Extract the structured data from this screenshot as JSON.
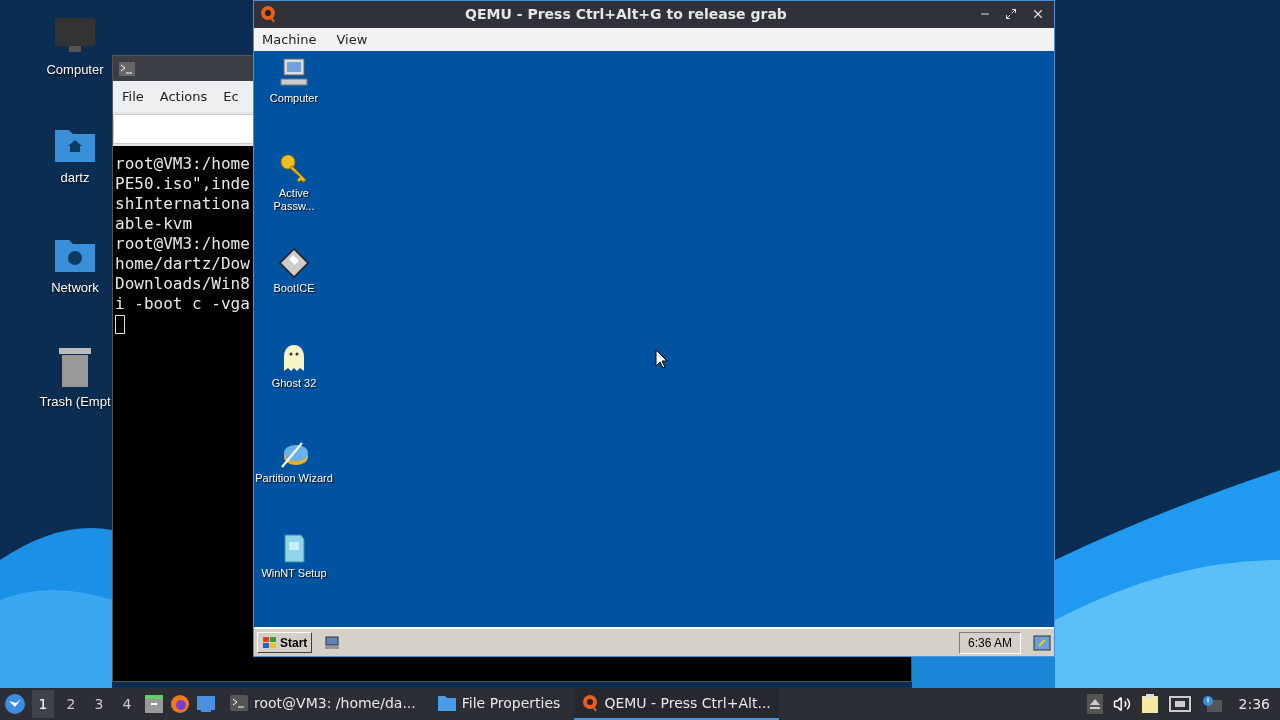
{
  "desktop": {
    "icons": [
      {
        "label": "Computer",
        "kind": "monitor"
      },
      {
        "label": "dartz",
        "kind": "home-folder"
      },
      {
        "label": "Network",
        "kind": "network-folder"
      },
      {
        "label": "Trash (Empt",
        "kind": "trash"
      }
    ]
  },
  "terminal_window": {
    "menu": [
      "File",
      "Actions",
      "Ec"
    ],
    "lines": [
      "root@VM3:/home",
      "PE50.iso\",inde",
      "shInternationa",
      "able-kvm",
      "root@VM3:/home",
      "home/dartz/Dow",
      "Downloads/Win8",
      "i -boot c -vga"
    ]
  },
  "qemu_window": {
    "title": "QEMU - Press Ctrl+Alt+G to release grab",
    "menu": [
      "Machine",
      "View"
    ],
    "guest": {
      "icons": [
        {
          "label": "Computer",
          "kind": "computer"
        },
        {
          "label": "Active\nPassw...",
          "kind": "key"
        },
        {
          "label": "BootICE",
          "kind": "floppy"
        },
        {
          "label": "Ghost 32",
          "kind": "ghost"
        },
        {
          "label": "Partition Wizard",
          "kind": "wizard"
        },
        {
          "label": "WinNT Setup",
          "kind": "setup"
        }
      ],
      "start_button": "Start",
      "clock": "6:36 AM"
    }
  },
  "panel": {
    "workspaces": [
      {
        "label": "1",
        "selected": true
      },
      {
        "label": "2",
        "selected": false
      },
      {
        "label": "3",
        "selected": false
      },
      {
        "label": "4",
        "selected": false
      }
    ],
    "tasks": [
      {
        "label": "root@VM3: /home/da...",
        "kind": "terminal",
        "selected": false
      },
      {
        "label": "File Properties",
        "kind": "folder",
        "selected": false
      },
      {
        "label": "QEMU - Press Ctrl+Alt...",
        "kind": "qemu",
        "selected": true
      }
    ],
    "clock": "2:36"
  }
}
